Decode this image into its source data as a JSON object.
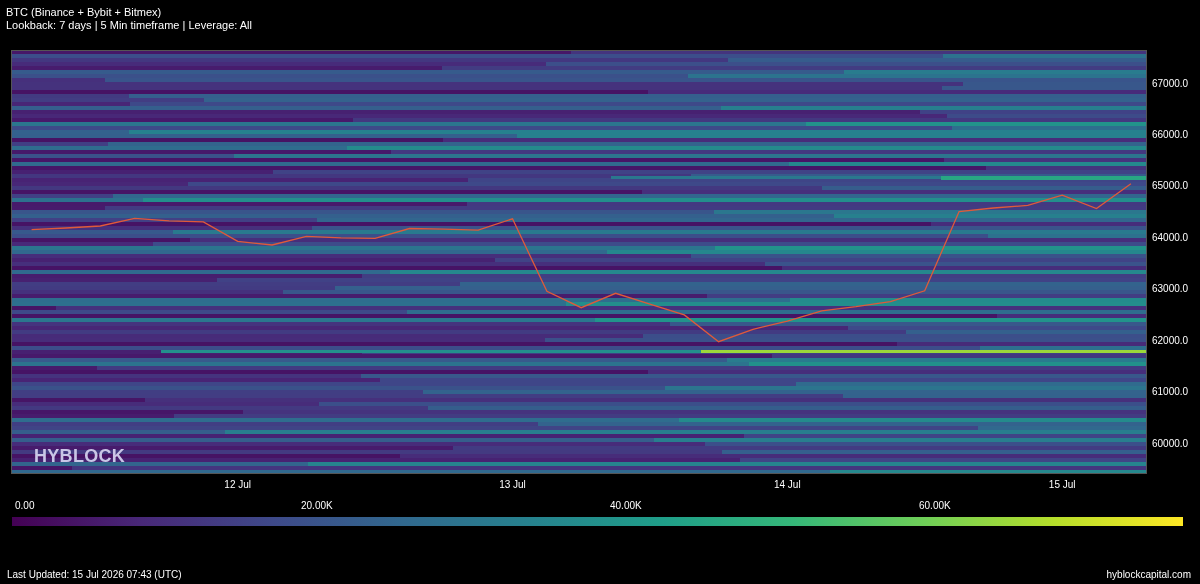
{
  "title": "BTC (Binance + Bybit + Bitmex)",
  "subtitle": "Lookback: 7 days | 5 Min timeframe | Leverage: All",
  "chart": {
    "watermark": "HYBLOCK",
    "chart_data": {
      "type": "line",
      "ylim": [
        59397,
        67642
      ],
      "yticks": [
        {
          "value": 67000,
          "label": "67000.0"
        },
        {
          "value": 66000,
          "label": "66000.0"
        },
        {
          "value": 65000,
          "label": "65000.0"
        },
        {
          "value": 64000,
          "label": "64000.0"
        },
        {
          "value": 63000,
          "label": "63000.0"
        },
        {
          "value": 62000,
          "label": "62000.0"
        },
        {
          "value": 61000,
          "label": "61000.0"
        },
        {
          "value": 60000,
          "label": "60000.0"
        }
      ],
      "categories": [
        null,
        null,
        null,
        null,
        null,
        null,
        "12 Jul",
        null,
        null,
        null,
        null,
        null,
        null,
        null,
        "13 Jul",
        null,
        null,
        null,
        null,
        null,
        null,
        null,
        "14 Jul",
        null,
        null,
        null,
        null,
        null,
        null,
        null,
        "15 Jul",
        null,
        null
      ],
      "series": [
        {
          "color": "#e05a3a",
          "values": [
            64150,
            64180,
            64220,
            64370,
            64320,
            64300,
            63920,
            63850,
            64020,
            63990,
            63980,
            64170,
            64160,
            64140,
            64360,
            62950,
            62630,
            62910,
            62700,
            62490,
            61970,
            62210,
            62370,
            62570,
            62650,
            62750,
            62960,
            64500,
            64570,
            64620,
            64820,
            64560,
            65040
          ]
        }
      ]
    }
  },
  "colorbar": {
    "ticks": [
      "0.00",
      "20.00K",
      "40.00K",
      "60.00K"
    ]
  },
  "footer": {
    "last_updated": "Last Updated: 15 Jul 2026 07:43 (UTC)",
    "site": "hyblockcapital.com"
  }
}
